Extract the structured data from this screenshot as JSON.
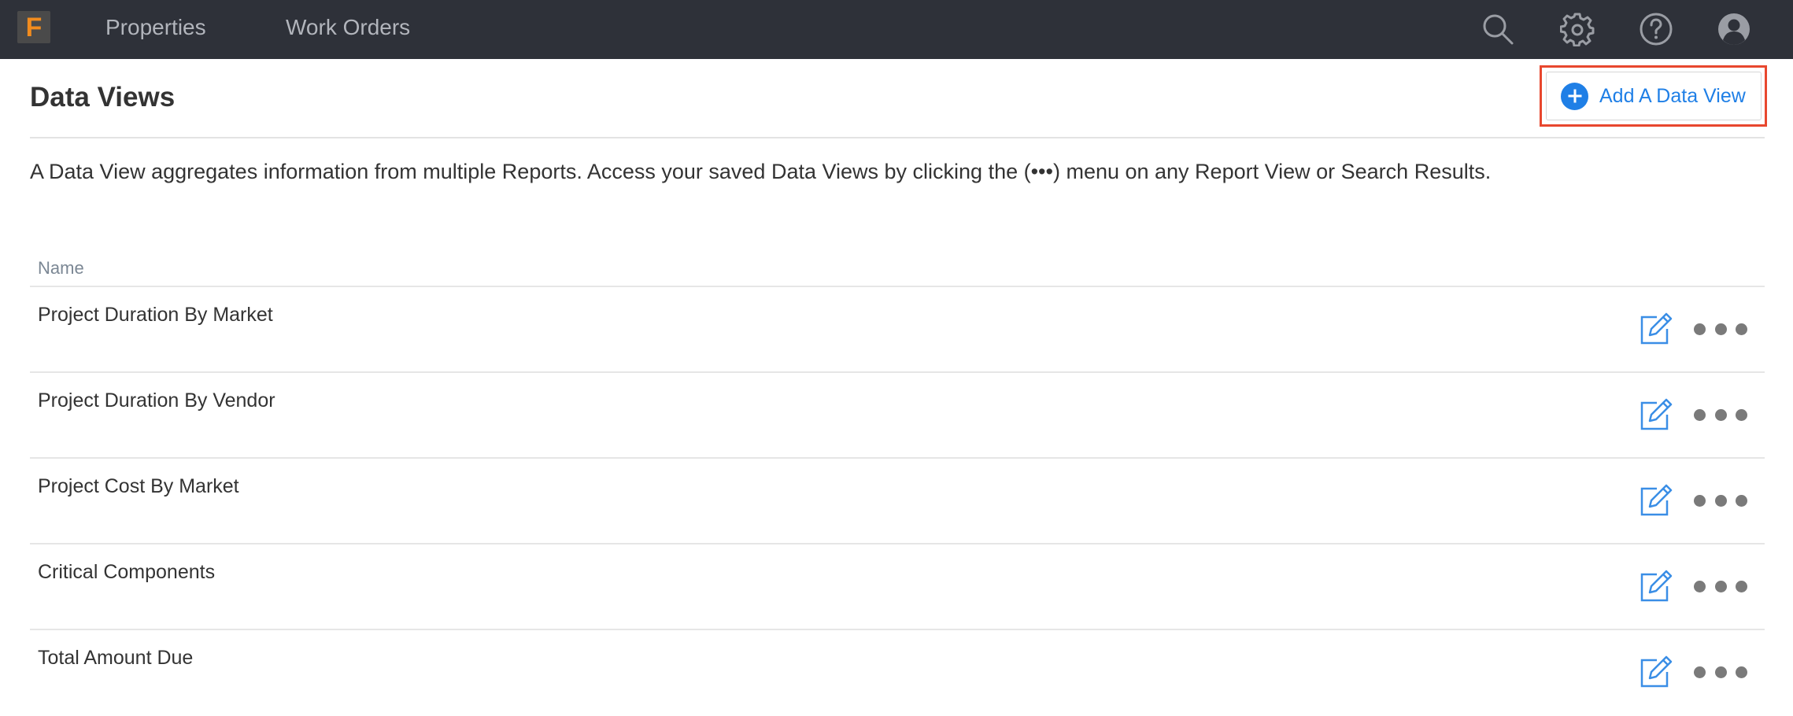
{
  "nav": {
    "logo_letter": "F",
    "links": [
      "Properties",
      "Work Orders"
    ],
    "icons": [
      "search-icon",
      "gear-icon",
      "help-icon",
      "user-icon"
    ]
  },
  "page": {
    "title": "Data Views",
    "add_button_label": "Add A Data View",
    "description": "A Data View aggregates information from multiple Reports. Access your saved Data Views by clicking the (•••) menu on any Report View or Search Results."
  },
  "table": {
    "column_header": "Name",
    "rows": [
      {
        "name": "Project Duration By Market"
      },
      {
        "name": "Project Duration By Vendor"
      },
      {
        "name": "Project Cost By Market"
      },
      {
        "name": "Critical Components"
      },
      {
        "name": "Total Amount Due"
      }
    ]
  },
  "colors": {
    "nav_bg": "#2e3139",
    "accent_blue": "#1f7fe6",
    "highlight_red": "#e8472e",
    "logo_orange": "#f28c1e"
  }
}
